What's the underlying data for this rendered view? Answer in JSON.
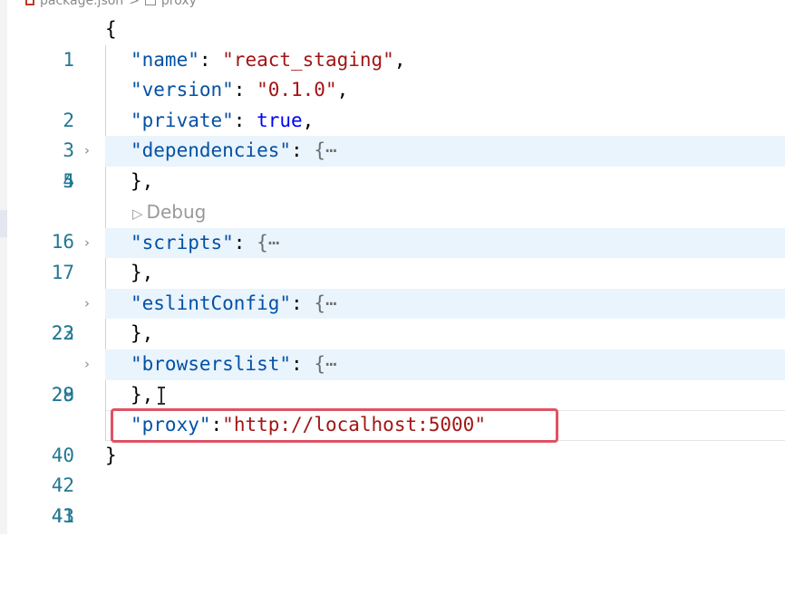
{
  "breadcrumb": {
    "file": "package.json",
    "separator": ">",
    "symbol": "proxy"
  },
  "codelens": {
    "label": "Debug"
  },
  "lines": [
    {
      "num": "1"
    },
    {
      "num": "2",
      "key": "\"name\"",
      "value": "\"react_staging\""
    },
    {
      "num": "3",
      "key": "\"version\"",
      "value": "\"0.1.0\""
    },
    {
      "num": "4",
      "key": "\"private\"",
      "value": "true"
    },
    {
      "num": "5",
      "key": "\"dependencies\"",
      "collapsed": "{⋯"
    },
    {
      "num": "16"
    },
    {
      "num": "17",
      "key": "\"scripts\"",
      "collapsed": "{⋯"
    },
    {
      "num": "22"
    },
    {
      "num": "23",
      "key": "\"eslintConfig\"",
      "collapsed": "{⋯"
    },
    {
      "num": "28"
    },
    {
      "num": "29",
      "key": "\"browserslist\"",
      "collapsed": "{⋯"
    },
    {
      "num": "40"
    },
    {
      "num": "41",
      "key": "\"proxy\"",
      "value": "\"http://localhost:5000\""
    },
    {
      "num": "42"
    },
    {
      "num": "43"
    }
  ],
  "punct": {
    "open_brace": "{",
    "close_brace": "}",
    "close_brace_comma": "},",
    "colon_space": ": ",
    "colon": ":",
    "comma": ","
  },
  "colors": {
    "key": "#0451a5",
    "string": "#a31515",
    "boolean": "#0000ff",
    "line_number": "#237893",
    "highlight_box": "#e05262",
    "fold_background": "#eaf4fc"
  }
}
